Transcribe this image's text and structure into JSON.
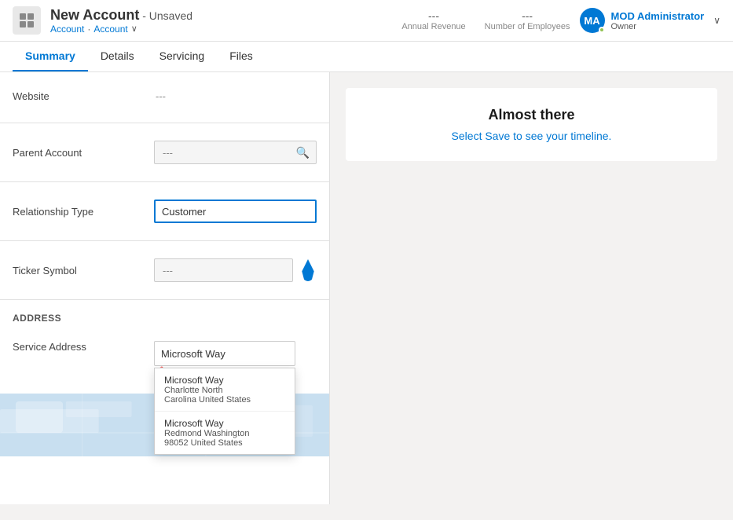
{
  "header": {
    "icon": "📋",
    "title": "New Account",
    "unsaved": "- Unsaved",
    "breadcrumb1": "Account",
    "breadcrumb2": "Account",
    "annual_revenue_label": "Annual Revenue",
    "annual_revenue_value": "---",
    "num_employees_label": "Number of Employees",
    "num_employees_value": "---",
    "owner_initials": "MA",
    "owner_name": "MOD Administrator",
    "owner_role": "Owner",
    "chevron": "∨"
  },
  "tabs": [
    {
      "id": "summary",
      "label": "Summary",
      "active": true
    },
    {
      "id": "details",
      "label": "Details",
      "active": false
    },
    {
      "id": "servicing",
      "label": "Servicing",
      "active": false
    },
    {
      "id": "files",
      "label": "Files",
      "active": false
    }
  ],
  "form": {
    "website_label": "Website",
    "website_value": "---",
    "parent_account_label": "Parent Account",
    "parent_account_value": "---",
    "relationship_type_label": "Relationship Type",
    "relationship_type_value": "Customer",
    "ticker_symbol_label": "Ticker Symbol",
    "ticker_symbol_value": "---",
    "address_section_label": "ADDRESS",
    "service_address_label": "Service Address",
    "service_address_value": "Microsoft Way"
  },
  "suggestions": [
    {
      "id": 1,
      "title": "Microsoft Way",
      "subtitle": "Charlotte North Carolina United States"
    },
    {
      "id": 2,
      "title": "Microsoft Way",
      "subtitle": "Redmond Washington 98052 United States"
    }
  ],
  "timeline": {
    "title": "Almost there",
    "message": "Select Save to see your timeline."
  }
}
